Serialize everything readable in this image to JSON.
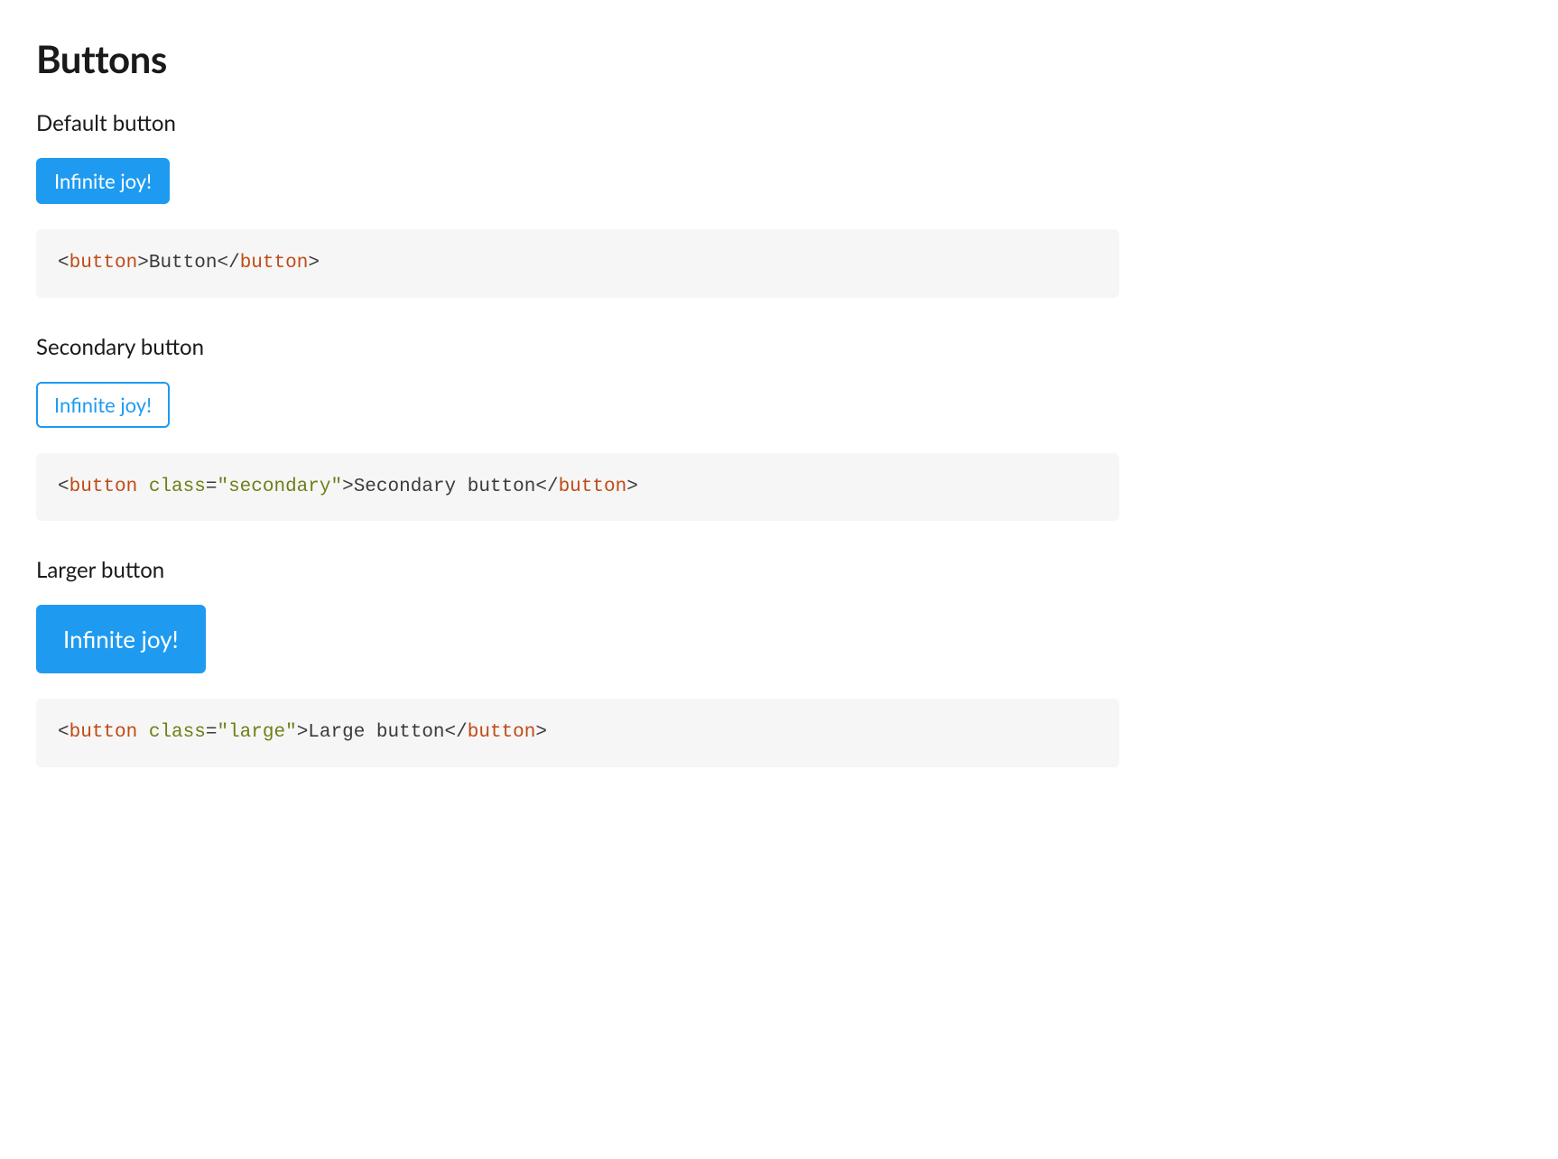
{
  "heading": "Buttons",
  "sections": {
    "default": {
      "title": "Default button",
      "button_label": "Infinite joy!",
      "code": {
        "open_bracket": "<",
        "tag_open": "button",
        "close_bracket_open": ">",
        "inner_text": "Button",
        "open_bracket_close": "</",
        "tag_close": "button",
        "close_bracket_close": ">"
      }
    },
    "secondary": {
      "title": "Secondary button",
      "button_label": "Infinite joy!",
      "code": {
        "open_bracket": "<",
        "tag_open": "button",
        "space1": " ",
        "attr_name": "class",
        "eq": "=",
        "attr_value": "\"secondary\"",
        "close_bracket_open": ">",
        "inner_text": "Secondary button",
        "open_bracket_close": "</",
        "tag_close": "button",
        "close_bracket_close": ">"
      }
    },
    "large": {
      "title": "Larger button",
      "button_label": "Infinite joy!",
      "code": {
        "open_bracket": "<",
        "tag_open": "button",
        "space1": " ",
        "attr_name": "class",
        "eq": "=",
        "attr_value": "\"large\"",
        "close_bracket_open": ">",
        "inner_text": "Large button",
        "open_bracket_close": "</",
        "tag_close": "button",
        "close_bracket_close": ">"
      }
    }
  }
}
